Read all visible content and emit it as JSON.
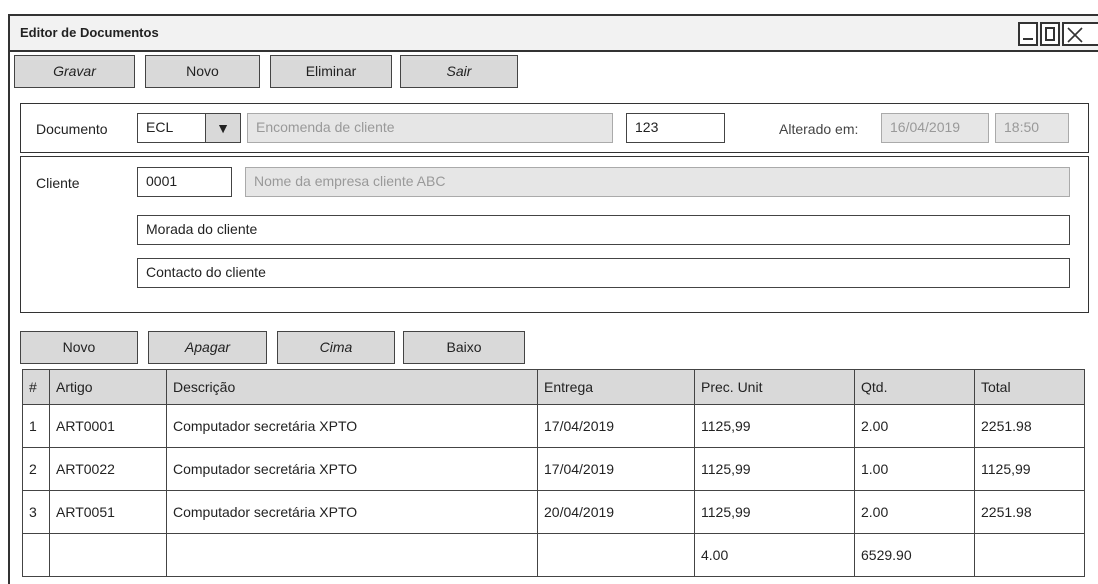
{
  "window": {
    "title": "Editor de Documentos"
  },
  "toolbar": {
    "save": "Gravar",
    "new": "Novo",
    "delete": "Eliminar",
    "exit": "Sair"
  },
  "document": {
    "label": "Documento",
    "type": "ECL",
    "description": "Encomenda de cliente",
    "number": "123",
    "changed_label": "Alterado em:",
    "changed_date": "16/04/2019",
    "changed_time": "18:50"
  },
  "client": {
    "label": "Cliente",
    "code": "0001",
    "name": "Nome da empresa cliente ABC",
    "address": "Morada do cliente",
    "contact": "Contacto do cliente"
  },
  "lines_toolbar": {
    "new": "Novo",
    "delete": "Apagar",
    "up": "Cima",
    "down": "Baixo"
  },
  "table": {
    "headers": [
      "#",
      "Artigo",
      "Descrição",
      "Entrega",
      "Prec. Unit",
      "Qtd.",
      "Total"
    ],
    "rows": [
      [
        "1",
        "ART0001",
        "Computador secretária XPTO",
        "17/04/2019",
        "1125,99",
        "2.00",
        "2251.98"
      ],
      [
        "2",
        "ART0022",
        "Computador secretária XPTO",
        "17/04/2019",
        "1125,99",
        "1.00",
        "1125,99"
      ],
      [
        "3",
        "ART0051",
        "Computador secretária XPTO",
        "20/04/2019",
        "1125,99",
        "2.00",
        "2251.98"
      ]
    ],
    "totals": [
      "",
      "",
      "",
      "",
      "4.00",
      "6529.90",
      ""
    ]
  }
}
